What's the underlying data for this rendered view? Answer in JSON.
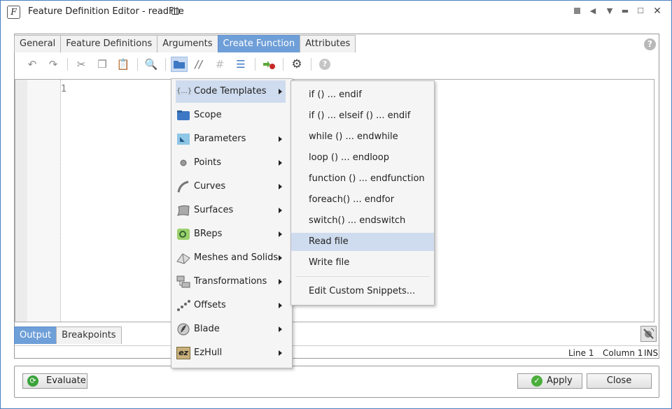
{
  "window": {
    "icon_letter": "F",
    "title": "Feature Definition Editor - readFile"
  },
  "tabs": [
    {
      "label": "General",
      "active": false
    },
    {
      "label": "Feature Definitions",
      "active": false
    },
    {
      "label": "Arguments",
      "active": false
    },
    {
      "label": "Create Function",
      "active": true
    },
    {
      "label": "Attributes",
      "active": false
    }
  ],
  "toolbar": {
    "icons": [
      "undo-icon",
      "redo-icon",
      "cut-icon",
      "copy-icon",
      "paste-icon",
      "search-icon",
      "folder-icon",
      "comment-icon",
      "grid-icon",
      "indent-icon",
      "add-breakpoint-icon",
      "settings-icon",
      "help-icon"
    ],
    "active_icon": "folder-icon"
  },
  "editor": {
    "line_number": "1"
  },
  "menu": {
    "items": [
      {
        "label": "Code Templates",
        "submenu": true,
        "icon": "code-templates-icon"
      },
      {
        "label": "Scope",
        "submenu": false,
        "icon": "scope-folder-icon"
      },
      {
        "label": "Parameters",
        "submenu": true,
        "icon": "parameters-icon"
      },
      {
        "label": "Points",
        "submenu": true,
        "icon": "point-icon"
      },
      {
        "label": "Curves",
        "submenu": true,
        "icon": "curve-icon"
      },
      {
        "label": "Surfaces",
        "submenu": true,
        "icon": "surface-icon"
      },
      {
        "label": "BReps",
        "submenu": true,
        "icon": "brep-icon"
      },
      {
        "label": "Meshes and Solids",
        "submenu": true,
        "icon": "mesh-icon"
      },
      {
        "label": "Transformations",
        "submenu": true,
        "icon": "transformation-icon"
      },
      {
        "label": "Offsets",
        "submenu": true,
        "icon": "offsets-icon"
      },
      {
        "label": "Blade",
        "submenu": true,
        "icon": "blade-icon"
      },
      {
        "label": "EzHull",
        "submenu": true,
        "icon": "ezhull-icon"
      }
    ],
    "code_templates_icon_text": "{...}",
    "ezhull_icon_text": "ez"
  },
  "submenu": {
    "items": [
      "if () ... endif",
      "if () ... elseif () ... endif",
      "while () ... endwhile",
      "loop () ... endloop",
      "function () ... endfunction",
      "foreach() ... endfor",
      "switch() ... endswitch",
      "Read file",
      "Write file"
    ],
    "highlighted": "Read file",
    "custom": "Edit Custom Snippets..."
  },
  "bottom_tabs": [
    {
      "label": "Output",
      "active": true
    },
    {
      "label": "Breakpoints",
      "active": false
    }
  ],
  "status": {
    "line": "Line 1",
    "column": "Column 1",
    "mode": "INS"
  },
  "buttons": {
    "evaluate": "Evaluate",
    "apply": "Apply",
    "close": "Close"
  },
  "colors": {
    "tab_active": "#6f9fd8",
    "menu_highlight": "#cfdcef",
    "apply_icon": "#4caf3c"
  }
}
